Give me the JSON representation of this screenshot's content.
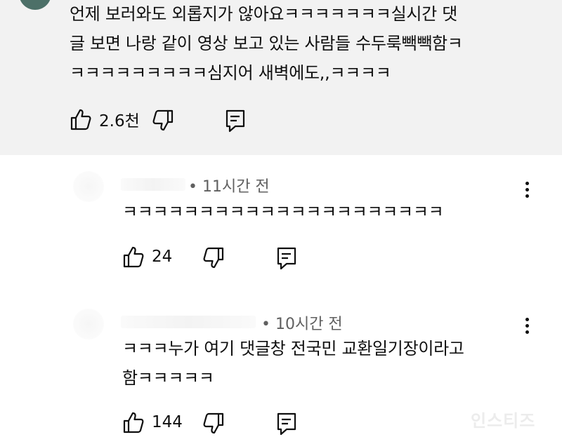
{
  "comments": [
    {
      "text_lines": [
        "언제 보러와도 외롭지가 않아요ㅋㅋㅋㅋㅋㅋㅋ실시간 댓",
        "글 보면 나랑 같이 영상 보고 있는 사람들 수두룩빽빽함ㅋ",
        "ㅋㅋㅋㅋㅋㅋㅋㅋㅋ심지어 새벽에도,,ㅋㅋㅋㅋ"
      ],
      "likes": "2.6천"
    },
    {
      "meta": "• 11시간 전",
      "text_lines": [
        "ㅋㅋㅋㅋㅋㅋㅋㅋㅋㅋㅋㅋㅋㅋㅋㅋㅋㅋㅋㅋㅋ"
      ],
      "likes": "24"
    },
    {
      "meta": "• 10시간 전",
      "text_lines": [
        "ㅋㅋㅋ누가 여기 댓글창 전국민 교환일기장이라고",
        "함ㅋㅋㅋㅋㅋ"
      ],
      "likes": "144"
    }
  ],
  "watermark": "인스티즈",
  "colors": {
    "highlight_bg": "#f2f2f2",
    "meta_text": "#606060",
    "text": "#0f0f0f"
  },
  "icons": [
    "thumb-up-icon",
    "thumb-down-icon",
    "reply-icon",
    "more-vert-icon"
  ]
}
